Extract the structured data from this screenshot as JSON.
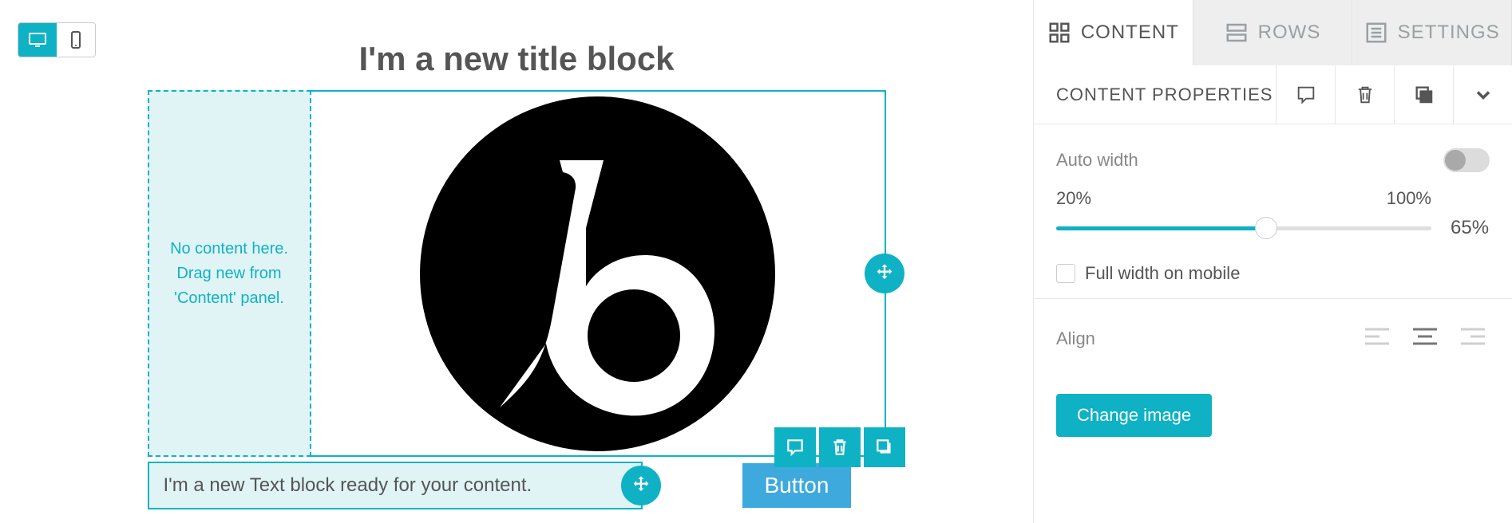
{
  "canvas": {
    "title": "I'm a new title block",
    "dropzone_text": "No content here. Drag new from 'Content' panel.",
    "text_block": "I'm a new Text block ready for your content.",
    "button_label": "Button"
  },
  "tabs": {
    "content": "CONTENT",
    "rows": "ROWS",
    "settings": "SETTINGS"
  },
  "panel": {
    "section_title": "CONTENT PROPERTIES",
    "auto_width_label": "Auto width",
    "slider_min_label": "20%",
    "slider_max_label": "100%",
    "slider_value": "65%",
    "slider_pct": 56,
    "full_width_mobile_label": "Full width on mobile",
    "align_label": "Align",
    "change_image_label": "Change image"
  },
  "colors": {
    "accent": "#0fb2c4"
  }
}
